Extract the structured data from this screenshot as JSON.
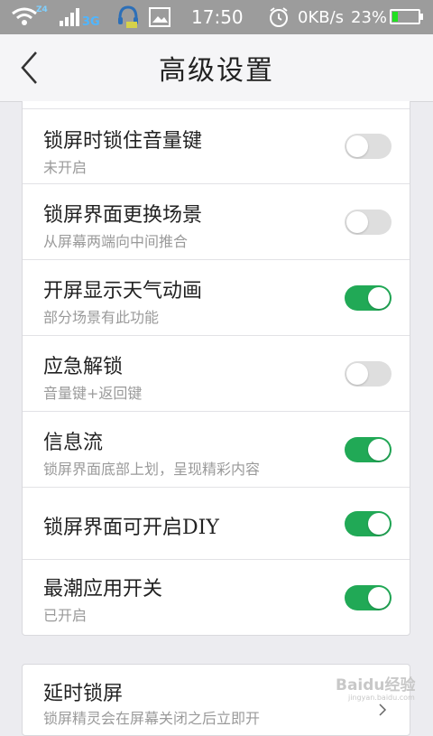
{
  "status_bar": {
    "wifi_label": "Z4",
    "network_type": "3G",
    "time": "17:50",
    "net_speed": "0KB/s",
    "battery_percent": "23%",
    "battery_level": 0.23,
    "colors": {
      "background": "#9c9c9c",
      "battery_fill": "#22e022"
    }
  },
  "header": {
    "title": "高级设置",
    "back_icon": "chevron-left-icon"
  },
  "settings": [
    {
      "title": "锁屏时锁住音量键",
      "subtitle": "未开启",
      "on": false
    },
    {
      "title": "锁屏界面更换场景",
      "subtitle": "从屏幕两端向中间推合",
      "on": false
    },
    {
      "title": "开屏显示天气动画",
      "subtitle": "部分场景有此功能",
      "on": true
    },
    {
      "title": "应急解锁",
      "subtitle": "音量键+返回键",
      "on": false
    },
    {
      "title": "信息流",
      "subtitle": "锁屏界面底部上划，呈现精彩内容",
      "on": true
    },
    {
      "title": "锁屏界面可开启DIY",
      "subtitle": "",
      "on": true
    },
    {
      "title": "最潮应用开关",
      "subtitle": "已开启",
      "on": true
    }
  ],
  "second_section": {
    "title": "延时锁屏",
    "subtitle": "锁屏精灵会在屏幕关闭之后立即开"
  },
  "watermark": {
    "text": "Baidu经验",
    "sub": "jingyan.baidu.com"
  },
  "colors": {
    "toggle_on": "#21a956",
    "toggle_off": "#dedede"
  }
}
